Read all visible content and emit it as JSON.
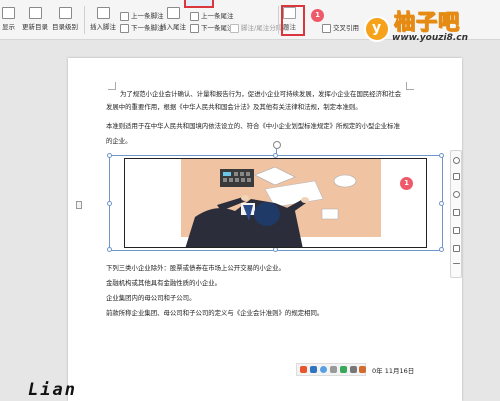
{
  "ribbon": {
    "paragraph_marks_label": "显示",
    "update_toc_label": "更新目录",
    "toc_level_label": "目录级别",
    "insert_footnote_label": "插入脚注",
    "prev_footnote_label": "上一条脚注",
    "next_footnote_label": "下一条脚注",
    "insert_endnote_label": "插入尾注",
    "prev_endnote_label": "上一条尾注",
    "next_endnote_label": "下一条尾注",
    "footnote_endnote_sep_label": "脚注/尾注分隔线",
    "footnote_label": "题注",
    "cross_ref_label": "交叉引用",
    "step_badge": "1"
  },
  "watermark": {
    "title": "柚子吧",
    "url": "www.youzi8.cn",
    "logo_letter": "y"
  },
  "document": {
    "paragraphs": [
      "为了规范小企业会计确认、计量和报告行为，促进小企业可持续发展，发挥小企业在国民经济和社会",
      "发展中的重要作用，根据《中华人民共和国会计法》及其他有关法律和法规，制定本准则。",
      "本准则适用于在中华人民共和国境内依法设立的、符合《中小企业划型标准规定》所规定的小型企业标准",
      "的企业。"
    ],
    "exclusions": [
      "下列三类小企业除外：股票或债券在市场上公开交易的小企业。",
      "金融机构或其他具有金融性质的小企业。",
      "企业集团内的母公司和子公司。",
      "前款所称企业集团、母公司和子公司的定义与《企业会计准则》的规定相同。"
    ],
    "image_badge": "1",
    "date_text": "0年 11月16日"
  },
  "signature": "Lian",
  "colors": {
    "highlight_red": "#d9363e",
    "watermark_orange": "#f6a21b",
    "illustration_desk": "#f0c3a3"
  }
}
